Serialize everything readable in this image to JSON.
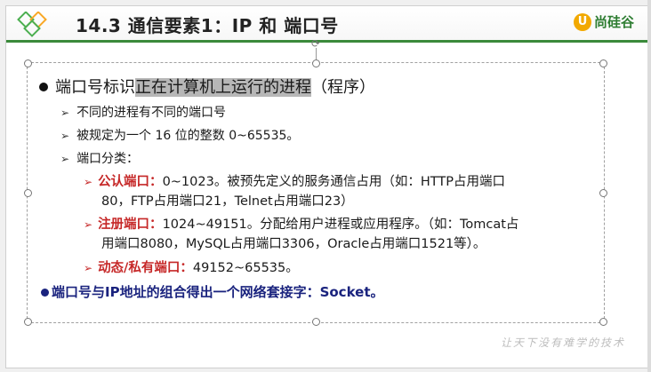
{
  "slide": {
    "title": "14.3 通信要素1：IP 和 端口号",
    "brand_name": "尚硅谷",
    "brand_mark": "U",
    "motto": "让天下没有难学的技术"
  },
  "content": {
    "l1_prefix": "端口号标识",
    "l1_highlight": "正在计算机上运行的进程",
    "l1_suffix": "（程序）",
    "items": [
      "不同的进程有不同的端口号",
      "被规定为一个 16 位的整数 0~65535。",
      "端口分类："
    ],
    "categories": [
      {
        "label": "公认端口：",
        "text_line1": "0~1023。被预先定义的服务通信占用（如：HTTP占用端口",
        "text_line2": "80，FTP占用端口21，Telnet占用端口23）"
      },
      {
        "label": "注册端口：",
        "text_line1": "1024~49151。分配给用户进程或应用程序。（如：Tomcat占",
        "text_line2": "用端口8080，MySQL占用端口3306，Oracle占用端口1521等）。"
      },
      {
        "label": "动态/私有端口：",
        "text_line1": "49152~65535。"
      }
    ],
    "conclusion": "端口号与IP地址的组合得出一个网络套接字：Socket。"
  },
  "colors": {
    "accent_green": "#3a8a3a",
    "category_red": "#c62828",
    "conclusion_blue": "#1a237e",
    "highlight_gray": "#b7b7b7"
  }
}
